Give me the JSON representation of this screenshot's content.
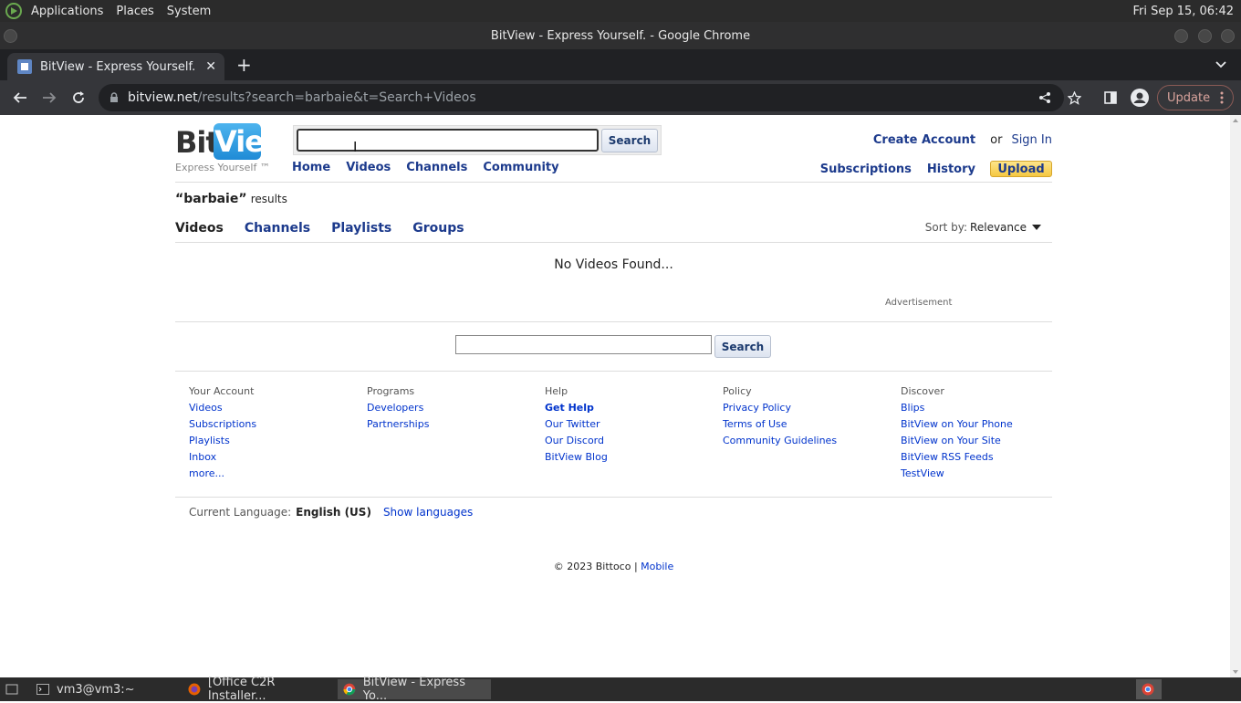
{
  "top_panel": {
    "menus": [
      "Applications",
      "Places",
      "System"
    ],
    "clock": "Fri Sep 15, 06:42"
  },
  "window": {
    "title": "BitView - Express Yourself. - Google Chrome"
  },
  "browser": {
    "tab_title": "BitView - Express Yourself.",
    "url_host": "bitview.net",
    "url_path": "/results?search=barbaie&t=Search+Videos",
    "update_label": "Update"
  },
  "site": {
    "logo_bit": "Bit",
    "logo_view": "View",
    "tagline": "Express Yourself ™",
    "search_button": "Search",
    "search_value": "",
    "nav": [
      "Home",
      "Videos",
      "Channels",
      "Community"
    ],
    "create_account": "Create Account",
    "or": "or",
    "sign_in": "Sign In",
    "subscriptions": "Subscriptions",
    "history": "History",
    "upload": "Upload"
  },
  "results": {
    "query": "“barbaie”",
    "suffix": "results",
    "tabs": [
      "Videos",
      "Channels",
      "Playlists",
      "Groups"
    ],
    "active_tab": "Videos",
    "sort_label": "Sort by:",
    "sort_value": "Relevance",
    "empty_message": "No Videos Found...",
    "advertisement": "Advertisement"
  },
  "footer": {
    "search_button": "Search",
    "columns": [
      {
        "heading": "Your Account",
        "items": [
          "Videos",
          "Subscriptions",
          "Playlists",
          "Inbox",
          "more..."
        ]
      },
      {
        "heading": "Programs",
        "items": [
          "Developers",
          "Partnerships"
        ]
      },
      {
        "heading": "Help",
        "items": [
          "Get Help",
          "Our Twitter",
          "Our Discord",
          "BitView Blog"
        ]
      },
      {
        "heading": "Policy",
        "items": [
          "Privacy Policy",
          "Terms of Use",
          "Community Guidelines"
        ]
      },
      {
        "heading": "Discover",
        "items": [
          "Blips",
          "BitView on Your Phone",
          "BitView on Your Site",
          "BitView RSS Feeds",
          "TestView"
        ]
      }
    ],
    "language_label": "Current Language:",
    "language_value": "English (US)",
    "show_languages": "Show languages",
    "copyright": "© 2023 Bittoco |",
    "mobile": "Mobile"
  },
  "taskbar": {
    "items": [
      "vm3@vm3:~",
      "[Office C2R Installer...",
      "BitView - Express Yo..."
    ]
  }
}
